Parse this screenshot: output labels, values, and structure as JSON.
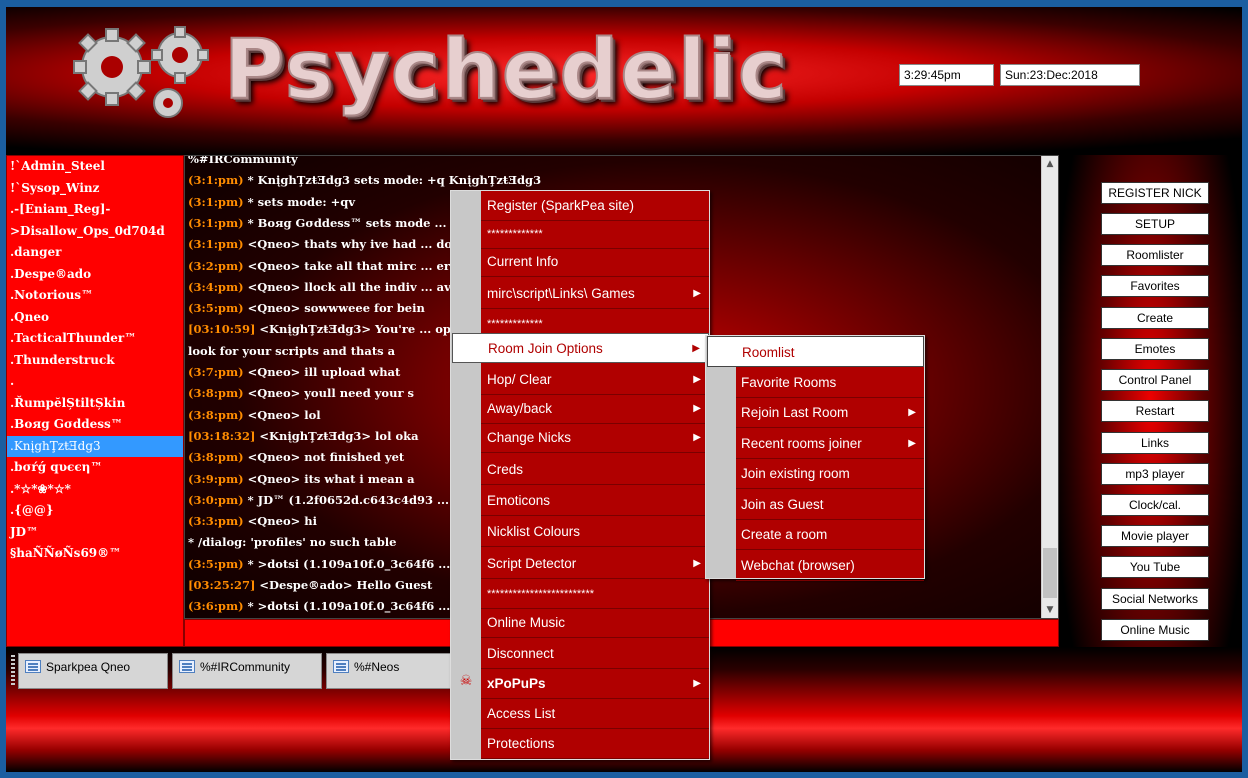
{
  "header": {
    "logo_text": "Psychedelic",
    "time": "3:29:45pm",
    "date": "Sun:23:Dec:2018"
  },
  "nicklist": [
    "!`Admin_Steel",
    "!`Sysop_Winz",
    ".-[Eniam_Reg]-",
    ">Disallow_Ops_0d704d",
    ".danger",
    ".Despe®ado",
    ".Notorious™",
    ".Qneo",
    ".TacticalThunder™",
    ".Thunderstruck",
    ".",
    ".ŘumpĕlȘtiltȘkin",
    ".Boяg Gσddess™",
    ".KnįghŢzŧƎdg3",
    ".bσŕǵ qυєєη™",
    ".*☆*❀*☆*",
    ".{@@}",
    "JD™",
    "§haÑÑøÑs69®™"
  ],
  "chat": {
    "lines": [
      {
        "ts": "",
        "text": "%#IRCommunity"
      },
      {
        "ts": "(3:1:pm)",
        "text": "* KnįghŢzŧƎdg3 sets mode: +q KnįghŢzŧƎdg3"
      },
      {
        "ts": "(3:1:pm)",
        "text": "*                    sets mode: +qv"
      },
      {
        "ts": "(3:1:pm)",
        "text": "* Boяg Gσddess™ sets mode ... g3"
      },
      {
        "ts": "(3:1:pm)",
        "text": "<Qneo> thats why ive had ... downloads"
      },
      {
        "ts": "(3:2:pm)",
        "text": "<Qneo> take all that mirc ... er it looks and feels"
      },
      {
        "ts": "(3:4:pm)",
        "text": "<Qneo> llock all the indiv ... ave it"
      },
      {
        "ts": "(3:5:pm)",
        "text": "<Qneo> sowwweee for bein"
      },
      {
        "ts": "[03:10:59]",
        "text": "<KnįghŢzŧƎdg3> You're ... opinions about how you like mIRC to"
      },
      {
        "ts": "",
        "text": "look for your scripts and thats a"
      },
      {
        "ts": "(3:7:pm)",
        "text": "<Qneo>  ill upload what"
      },
      {
        "ts": "(3:8:pm)",
        "text": "<Qneo> youll need your s"
      },
      {
        "ts": "(3:8:pm)",
        "text": "<Qneo> lol"
      },
      {
        "ts": "[03:18:32]",
        "text": "<KnįghŢzŧƎdg3> lol oka"
      },
      {
        "ts": "(3:8:pm)",
        "text": "<Qneo>  not finished yet"
      },
      {
        "ts": "(3:9:pm)",
        "text": "<Qneo> its what i mean a"
      },
      {
        "ts": "(3:0:pm)",
        "text": "* JD™ (1.2f0652d.c643c4d93 ... unity"
      },
      {
        "ts": "(3:3:pm)",
        "text": "<Qneo> hi"
      },
      {
        "ts": "",
        "text": "* /dialog: 'profiles' no such table"
      },
      {
        "ts": "(3:5:pm)",
        "text": "* >dotsi (1.109a10f.0_3c64f6 ... ity"
      },
      {
        "ts": "[03:25:27]",
        "text": "<Despe®ado> Hello Guest"
      },
      {
        "ts": "(3:6:pm)",
        "text": "* >dotsi (1.109a10f.0_3c64f6 ... est) has left %#IRCommunity"
      }
    ]
  },
  "right_buttons": [
    "REGISTER NICK",
    "SETUP",
    "Roomlister",
    "Favorites",
    "Create",
    "Emotes",
    "Control Panel",
    "Restart",
    "Links",
    "mp3 player",
    "Clock/cal.",
    "Movie player",
    "You Tube",
    "Social Networks",
    "Online Music"
  ],
  "switchbar": {
    "tabs": [
      "Sparkpea Qneo",
      "%#IRCommunity",
      "%#Neos"
    ]
  },
  "context_menu": {
    "items": [
      {
        "label": "Register (SparkPea site)",
        "arrow": false
      },
      {
        "label": "*************",
        "arrow": false
      },
      {
        "label": "Current Info",
        "arrow": false
      },
      {
        "label": "mirc\\script\\Links\\ Games",
        "arrow": true
      },
      {
        "label": "*************",
        "arrow": false
      },
      {
        "label": "Room Join Options",
        "arrow": true
      },
      {
        "label": "Hop/ Clear",
        "arrow": true
      },
      {
        "label": "Away/back",
        "arrow": true
      },
      {
        "label": "Change Nicks",
        "arrow": true
      },
      {
        "label": "Creds",
        "arrow": false
      },
      {
        "label": "Emoticons",
        "arrow": false
      },
      {
        "label": "Nicklist Colours",
        "arrow": false
      },
      {
        "label": "Script Detector",
        "arrow": true
      },
      {
        "label": "*************************",
        "arrow": false
      },
      {
        "label": "Online Music",
        "arrow": false
      },
      {
        "label": "Disconnect",
        "arrow": false
      },
      {
        "label": "xPoPuPs",
        "arrow": true
      },
      {
        "label": "Access List",
        "arrow": false
      },
      {
        "label": "Protections",
        "arrow": false
      }
    ]
  },
  "submenu": {
    "items": [
      {
        "label": "Roomlist",
        "arrow": false
      },
      {
        "label": "Favorite Rooms",
        "arrow": false
      },
      {
        "label": "Rejoin Last Room",
        "arrow": true
      },
      {
        "label": "Recent rooms joiner",
        "arrow": true
      },
      {
        "label": "Join existing room",
        "arrow": false
      },
      {
        "label": "Join as Guest",
        "arrow": false
      },
      {
        "label": "Create a room",
        "arrow": false
      },
      {
        "label": "Webchat (browser)",
        "arrow": false
      }
    ]
  }
}
